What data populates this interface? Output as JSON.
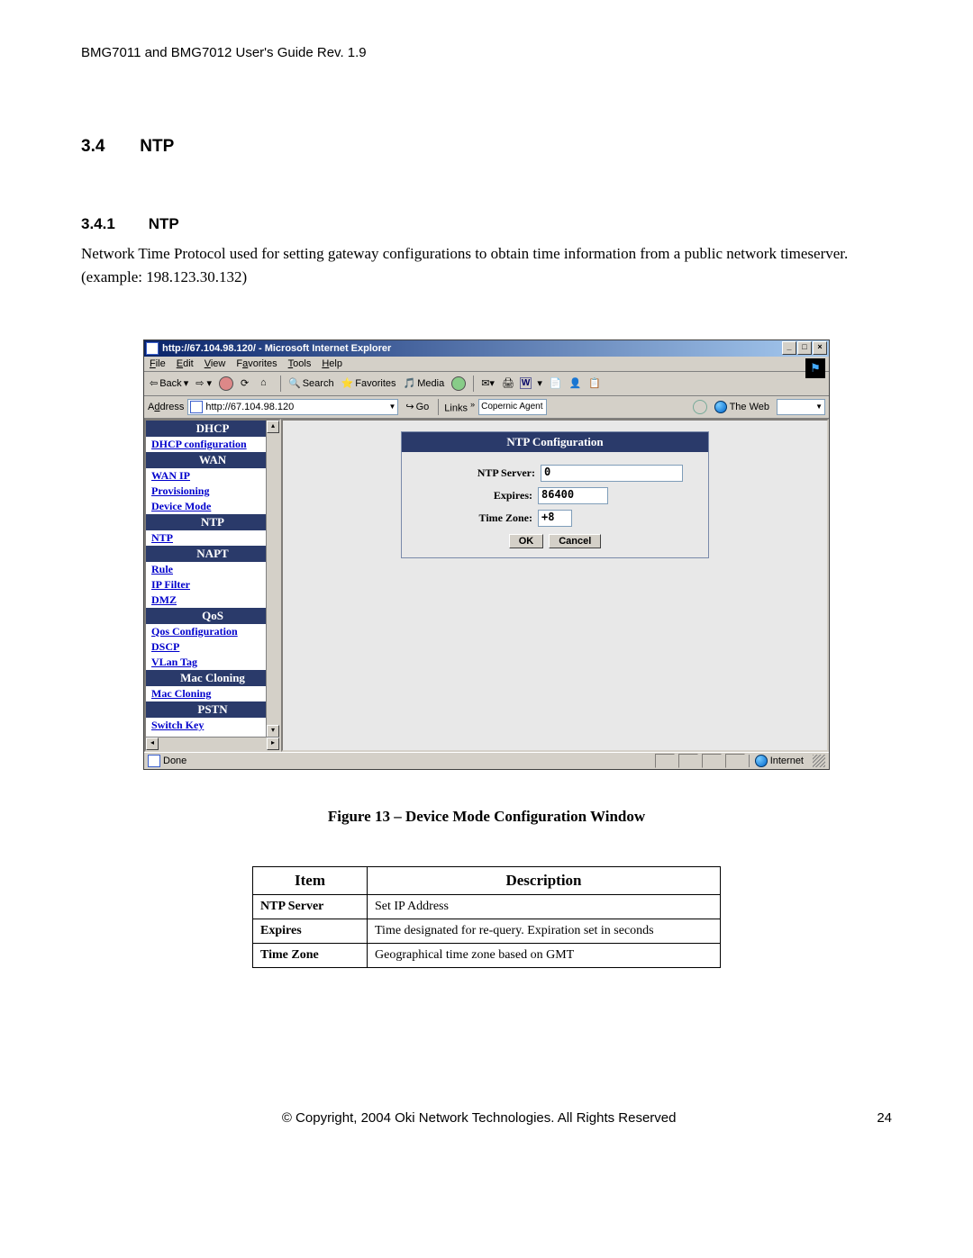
{
  "doc": {
    "header": "BMG7011 and BMG7012 User's Guide Rev. 1.9",
    "section_num": "3.4",
    "section_title": "NTP",
    "subsection_num": "3.4.1",
    "subsection_title": "NTP",
    "body": "Network Time Protocol used for setting gateway configurations to obtain time information from a public network timeserver. (example: 198.123.30.132)",
    "figure_caption": "Figure 13 – Device Mode Configuration Window",
    "footer_center": "© Copyright, 2004 Oki Network Technologies. All Rights Reserved",
    "page_number": "24"
  },
  "browser": {
    "title": "http://67.104.98.120/ - Microsoft Internet Explorer",
    "menu": {
      "file": "File",
      "edit": "Edit",
      "view": "View",
      "favorites": "Favorites",
      "tools": "Tools",
      "help": "Help"
    },
    "toolbar": {
      "back": "Back",
      "search": "Search",
      "favorites": "Favorites",
      "media": "Media"
    },
    "address_label": "Address",
    "address_value": "http://67.104.98.120",
    "go": "Go",
    "links": "Links",
    "copernic": "Copernic Agent",
    "the_web": "The Web",
    "status_done": "Done",
    "status_zone": "Internet"
  },
  "sidebar": {
    "items": [
      {
        "type": "head",
        "label": "DHCP"
      },
      {
        "type": "link",
        "label": "DHCP configuration"
      },
      {
        "type": "head",
        "label": "WAN"
      },
      {
        "type": "link",
        "label": "WAN IP"
      },
      {
        "type": "link",
        "label": "Provisioning"
      },
      {
        "type": "link",
        "label": "Device Mode"
      },
      {
        "type": "head",
        "label": "NTP"
      },
      {
        "type": "link",
        "label": "NTP"
      },
      {
        "type": "head",
        "label": "NAPT"
      },
      {
        "type": "link",
        "label": "Rule"
      },
      {
        "type": "link",
        "label": "IP Filter"
      },
      {
        "type": "link",
        "label": "DMZ"
      },
      {
        "type": "head",
        "label": "QoS"
      },
      {
        "type": "link",
        "label": "Qos Configuration"
      },
      {
        "type": "link",
        "label": "DSCP"
      },
      {
        "type": "link",
        "label": "VLan Tag"
      },
      {
        "type": "head",
        "label": "Mac Cloning"
      },
      {
        "type": "link",
        "label": "Mac Cloning"
      },
      {
        "type": "head",
        "label": "PSTN"
      },
      {
        "type": "link",
        "label": "Switch Key"
      }
    ]
  },
  "panel": {
    "title": "NTP Configuration",
    "ntp_server_label": "NTP Server:",
    "ntp_server_value": "0",
    "expires_label": "Expires:",
    "expires_value": "86400",
    "timezone_label": "Time Zone:",
    "timezone_value": "+8",
    "ok": "OK",
    "cancel": "Cancel"
  },
  "table": {
    "head_item": "Item",
    "head_desc": "Description",
    "rows": [
      {
        "item": "NTP Server",
        "desc": "Set IP Address"
      },
      {
        "item": "Expires",
        "desc": "Time designated for re-query. Expiration set in seconds"
      },
      {
        "item": "Time Zone",
        "desc": "Geographical time zone based on GMT"
      }
    ]
  }
}
